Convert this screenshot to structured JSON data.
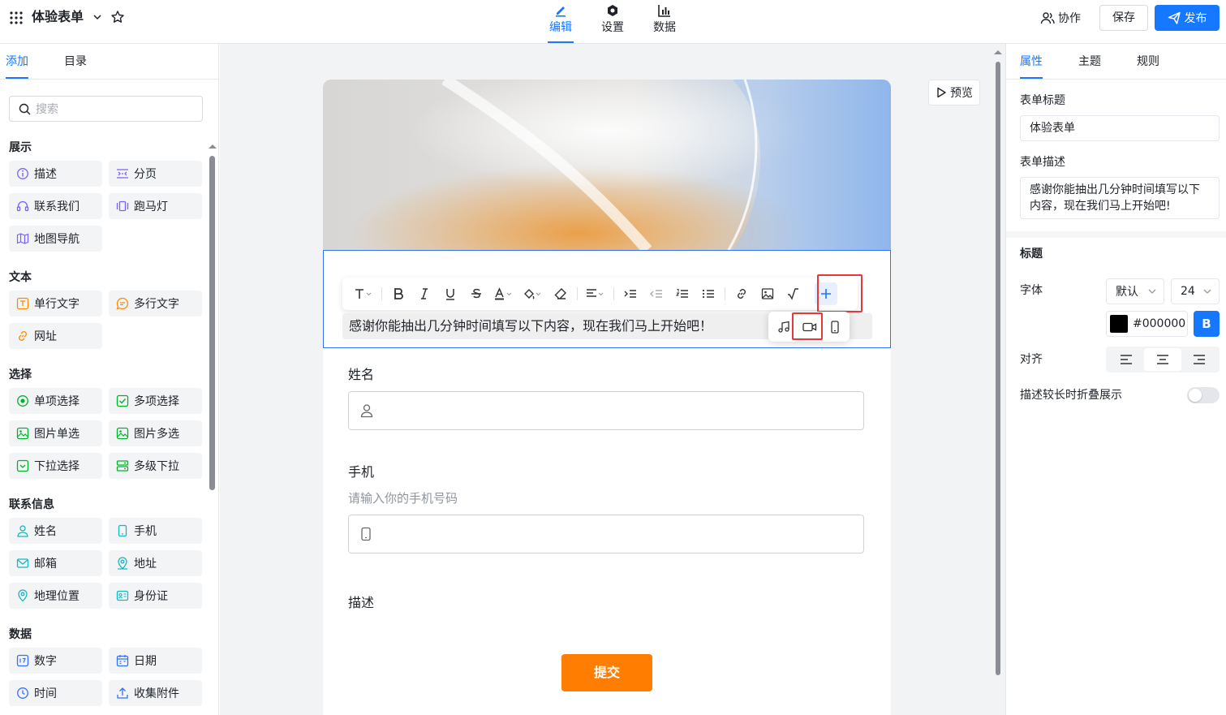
{
  "header": {
    "form_title": "体验表单",
    "center_tabs": [
      "编辑",
      "设置",
      "数据"
    ],
    "collab_label": "协作",
    "save_label": "保存",
    "publish_label": "发布"
  },
  "left": {
    "tabs": [
      "添加",
      "目录"
    ],
    "search_placeholder": "搜索",
    "sections": [
      {
        "title": "展示",
        "items": [
          {
            "label": "描述",
            "icon": "info-circle-icon",
            "color": "#7b61ff"
          },
          {
            "label": "分页",
            "icon": "pagination-icon",
            "color": "#7b61ff"
          },
          {
            "label": "联系我们",
            "icon": "headset-icon",
            "color": "#7b61ff"
          },
          {
            "label": "跑马灯",
            "icon": "carousel-icon",
            "color": "#7b61ff"
          },
          {
            "label": "地图导航",
            "icon": "map-icon",
            "color": "#7b61ff"
          }
        ]
      },
      {
        "title": "文本",
        "items": [
          {
            "label": "单行文字",
            "icon": "text-field-icon",
            "color": "#ff8a00"
          },
          {
            "label": "多行文字",
            "icon": "chat-text-icon",
            "color": "#ff8a00"
          },
          {
            "label": "网址",
            "icon": "link-icon",
            "color": "#ff8a00"
          }
        ]
      },
      {
        "title": "选择",
        "items": [
          {
            "label": "单项选择",
            "icon": "radio-icon",
            "color": "#00b42a"
          },
          {
            "label": "多项选择",
            "icon": "checkbox-icon",
            "color": "#00b42a"
          },
          {
            "label": "图片单选",
            "icon": "image-radio-icon",
            "color": "#00b42a"
          },
          {
            "label": "图片多选",
            "icon": "image-check-icon",
            "color": "#00b42a"
          },
          {
            "label": "下拉选择",
            "icon": "dropdown-icon",
            "color": "#00b42a"
          },
          {
            "label": "多级下拉",
            "icon": "cascade-icon",
            "color": "#00b42a"
          }
        ]
      },
      {
        "title": "联系信息",
        "items": [
          {
            "label": "姓名",
            "icon": "user-icon",
            "color": "#14b8c4"
          },
          {
            "label": "手机",
            "icon": "phone-icon",
            "color": "#14b8c4"
          },
          {
            "label": "邮箱",
            "icon": "mail-icon",
            "color": "#14b8c4"
          },
          {
            "label": "地址",
            "icon": "address-icon",
            "color": "#14b8c4"
          },
          {
            "label": "地理位置",
            "icon": "location-icon",
            "color": "#14b8c4"
          },
          {
            "label": "身份证",
            "icon": "id-card-icon",
            "color": "#14b8c4"
          }
        ]
      },
      {
        "title": "数据",
        "items": [
          {
            "label": "数字",
            "icon": "number-icon",
            "color": "#3370ff"
          },
          {
            "label": "日期",
            "icon": "calendar-icon",
            "color": "#3370ff"
          },
          {
            "label": "时间",
            "icon": "clock-icon",
            "color": "#3370ff"
          },
          {
            "label": "收集附件",
            "icon": "upload-icon",
            "color": "#3370ff"
          }
        ]
      }
    ]
  },
  "canvas": {
    "preview_label": "预览",
    "description": "感谢你能抽出几分钟时间填写以下内容，现在我们马上开始吧！",
    "fields": {
      "name_label": "姓名",
      "phone_label": "手机",
      "phone_hint": "请输入你的手机号码",
      "desc_label": "描述"
    },
    "submit_label": "提交"
  },
  "right": {
    "tabs": [
      "属性",
      "主题",
      "规则"
    ],
    "form_title_label": "表单标题",
    "form_title_value": "体验表单",
    "form_desc_label": "表单描述",
    "form_desc_value": "感谢你能抽出几分钟时间填写以下内容，现在我们马上开始吧!",
    "heading_label": "标题",
    "font_label": "字体",
    "font_value": "默认",
    "size_value": "24",
    "color_value": "#000000",
    "bold_label": "B",
    "align_label": "对齐",
    "collapse_label": "描述较长时折叠展示"
  },
  "colors": {
    "accent": "#1677ff",
    "submit": "#ff7d00",
    "highlight": "#e5383b"
  }
}
